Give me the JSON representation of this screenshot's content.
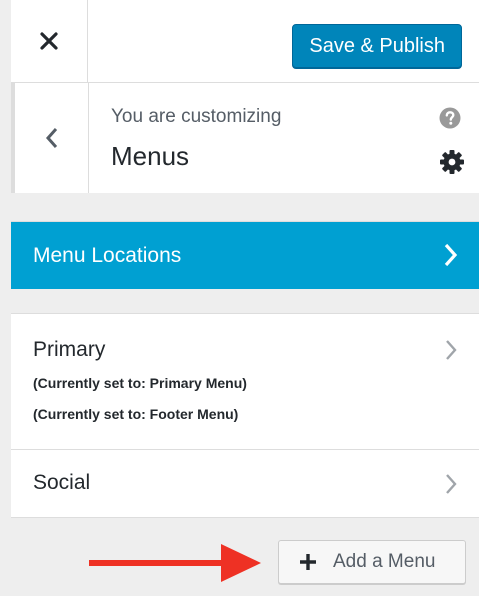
{
  "header": {
    "close_icon": "close-icon",
    "save_label": "Save & Publish"
  },
  "info": {
    "label": "You are customizing",
    "title": "Menus",
    "back_icon": "chevron-left-icon",
    "help_icon": "question-circle-icon",
    "settings_icon": "gear-icon"
  },
  "sections": {
    "menu_locations": {
      "label": "Menu Locations",
      "icon": "chevron-right-icon"
    },
    "primary": {
      "label": "Primary",
      "descriptions": [
        "(Currently set to: Primary Menu)",
        "(Currently set to: Footer Menu)"
      ],
      "icon": "chevron-right-icon"
    },
    "social": {
      "label": "Social",
      "icon": "chevron-right-icon"
    }
  },
  "footer": {
    "add_menu_label": "Add a Menu",
    "add_icon": "plus-icon",
    "annotation": "arrow-right-icon"
  },
  "colors": {
    "primary_button": "#0085ba",
    "active_section": "#00a0d2",
    "annotation_arrow": "#ee3124",
    "panel_background": "#eeeeee"
  }
}
